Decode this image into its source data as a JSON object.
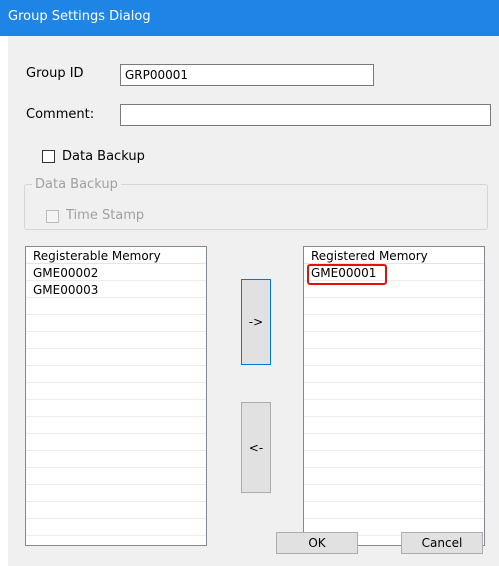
{
  "window": {
    "title": "Group Settings Dialog"
  },
  "form": {
    "group_id_label": "Group ID",
    "group_id_value": "GRP00001",
    "comment_label": "Comment:",
    "comment_value": "",
    "data_backup_label": "Data Backup",
    "data_backup_checked": false
  },
  "backup_group": {
    "legend": "Data Backup",
    "time_stamp_label": "Time Stamp",
    "time_stamp_checked": false,
    "enabled": false
  },
  "registerable": {
    "header": "Registerable Memory",
    "items": [
      "GME00002",
      "GME00003"
    ]
  },
  "registered": {
    "header": "Registered Memory",
    "items": [
      "GME00001"
    ]
  },
  "buttons": {
    "move_right": "->",
    "move_left": "<-",
    "ok": "OK",
    "cancel": "Cancel"
  },
  "colors": {
    "titlebar": "#1e84e6",
    "highlight": "#e31010"
  }
}
